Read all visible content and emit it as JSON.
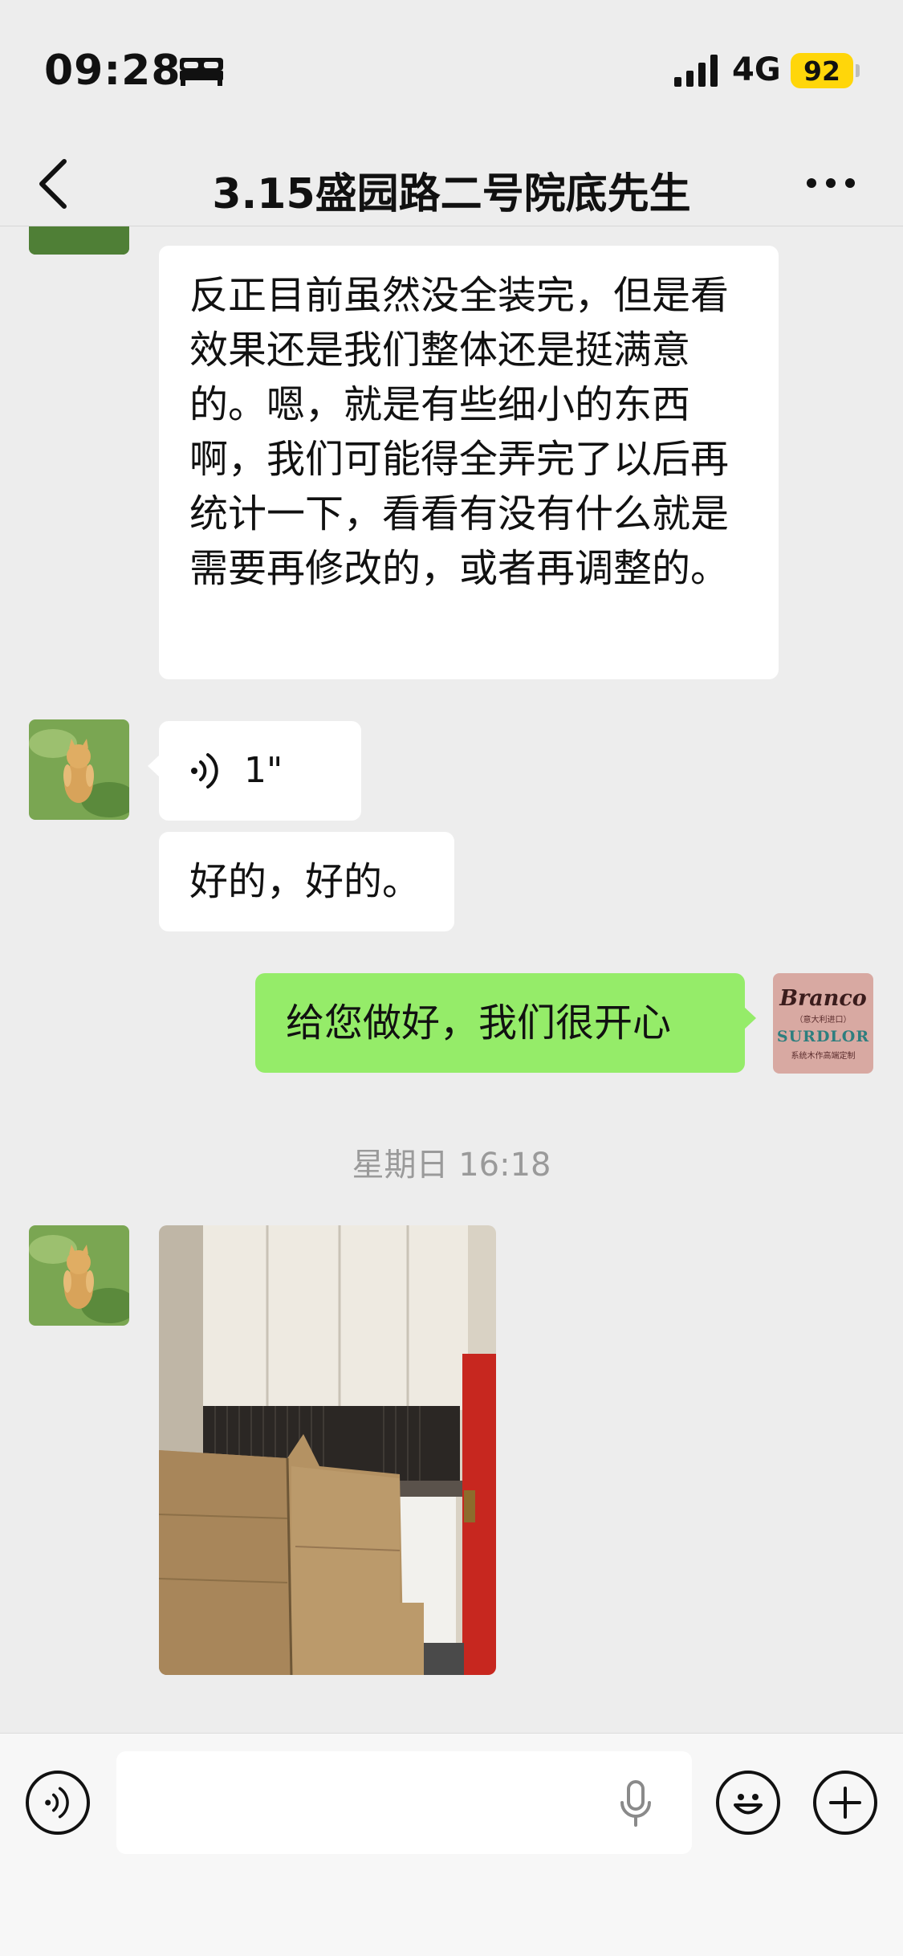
{
  "status_bar": {
    "time": "09:28",
    "network": "4G",
    "battery": "92",
    "icons": [
      "bed-icon",
      "signal-icon"
    ]
  },
  "nav": {
    "title": "3.15盛园路二号院底先生",
    "back_icon": "chevron-left-icon",
    "more_icon": "more-horizontal-icon"
  },
  "messages": {
    "long_text": {
      "sender": "contact",
      "text": "反正目前虽然没全装完，但是看效果还是我们整体还是挺满意的。嗯，就是有些细小的东西啊，我们可能得全弄完了以后再统计一下，看看有没有什么就是需要再修改的，或者再调整的。"
    },
    "voice": {
      "sender": "contact",
      "duration": "1\"",
      "icon": "voice-wave-icon"
    },
    "short_text": {
      "sender": "contact",
      "text": "好的，好的。"
    },
    "my_reply": {
      "sender": "me",
      "text": "给您做好，我们很开心"
    },
    "divider_time": "星期日 16:18",
    "photo": {
      "sender": "contact",
      "description_icon": "photo-thumbnail"
    }
  },
  "my_avatar": {
    "line1": "Branco",
    "line2": "（意大利进口）",
    "line3": "SURDLOR",
    "line4": "系统木作高端定制"
  },
  "input_bar": {
    "input_value": "",
    "icons": [
      "voice-mode-icon",
      "microphone-icon",
      "emoji-icon",
      "plus-icon"
    ]
  },
  "colors": {
    "background": "#ededed",
    "my_bubble": "#95ec69",
    "contact_bubble": "#ffffff",
    "battery": "#ffd60a"
  }
}
